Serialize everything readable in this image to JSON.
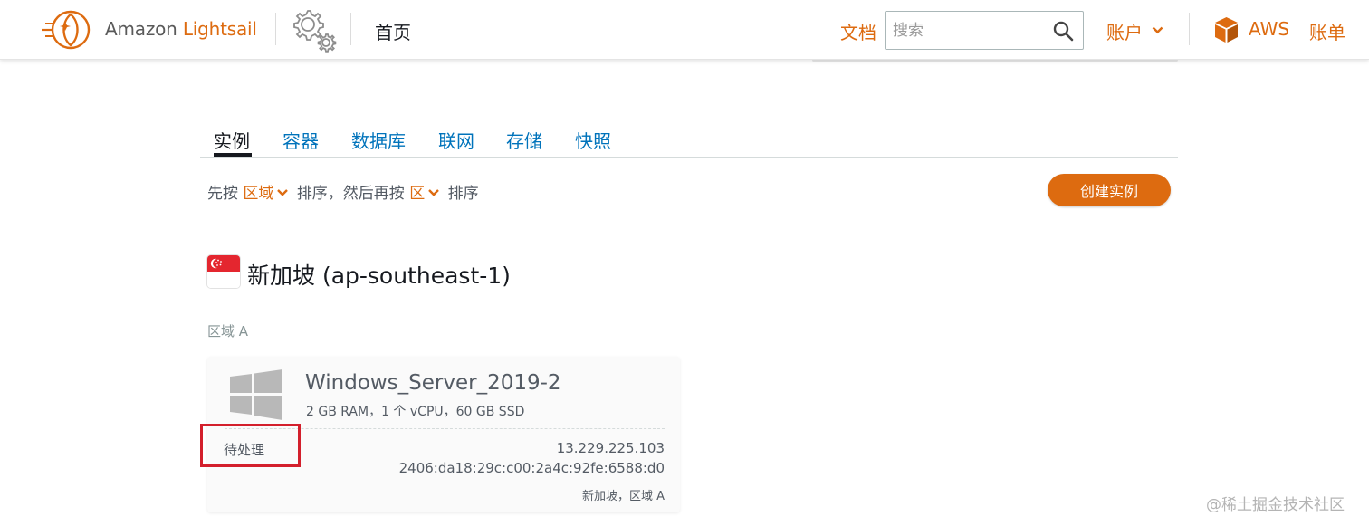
{
  "header": {
    "brand_prefix": "Amazon",
    "brand_strong": "Lightsail",
    "home_label": "首页",
    "docs_label": "文档",
    "search_placeholder": "搜索",
    "account_label": "账户",
    "aws_label": "AWS",
    "billing_label": "账单"
  },
  "tabs": [
    {
      "label": "实例",
      "active": true
    },
    {
      "label": "容器"
    },
    {
      "label": "数据库"
    },
    {
      "label": "联网"
    },
    {
      "label": "存储"
    },
    {
      "label": "快照"
    }
  ],
  "sort": {
    "prefix": "先按",
    "first_key": "区域",
    "middle": "排序，然后再按",
    "second_key": "区",
    "suffix": "排序"
  },
  "create_button_label": "创建实例",
  "region": {
    "title": "新加坡 (ap-southeast-1)",
    "zone_label": "区域 A"
  },
  "instance": {
    "name": "Windows_Server_2019-2",
    "spec": "2 GB RAM，1 个 vCPU，60 GB SSD",
    "status": "待处理",
    "ipv4": "13.229.225.103",
    "ipv6": "2406:da18:29c:c00:2a4c:92fe:6588:d0",
    "location": "新加坡，区域 A"
  },
  "watermark": "@稀土掘金技术社区",
  "colors": {
    "accent": "#dd6b10",
    "link": "#0073bb",
    "highlight_box": "#d31f2c"
  }
}
